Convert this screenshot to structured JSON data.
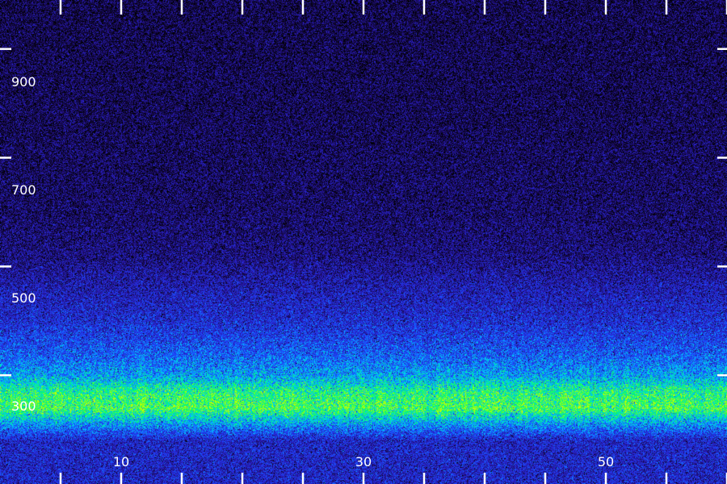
{
  "chart_data": {
    "type": "heatmap",
    "title": "",
    "xlabel": "",
    "ylabel": "",
    "x_range": [
      -5,
      55
    ],
    "y_range": [
      100,
      990
    ],
    "x_ticks": [
      {
        "value": 10,
        "label": "10"
      },
      {
        "value": 30,
        "label": "30"
      },
      {
        "value": 50,
        "label": "50"
      }
    ],
    "x_minor_ticks": [
      0,
      5,
      15,
      20,
      25,
      35,
      40,
      45,
      55
    ],
    "y_ticks": [
      {
        "value": 900,
        "label": "900"
      },
      {
        "value": 700,
        "label": "700"
      },
      {
        "value": 500,
        "label": "500"
      },
      {
        "value": 300,
        "label": "300"
      }
    ],
    "colormap": [
      "#000000",
      "#1a0a5a",
      "#2a20c8",
      "#1a4cff",
      "#00c8ff",
      "#00ff66",
      "#c8ff00"
    ],
    "intensity_profile": [
      {
        "y": 990,
        "level": 0.14
      },
      {
        "y": 800,
        "level": 0.15
      },
      {
        "y": 600,
        "level": 0.18
      },
      {
        "y": 520,
        "level": 0.22
      },
      {
        "y": 470,
        "level": 0.3
      },
      {
        "y": 400,
        "level": 0.38
      },
      {
        "y": 340,
        "level": 0.5
      },
      {
        "y": 300,
        "level": 0.62
      },
      {
        "y": 270,
        "level": 0.82
      },
      {
        "y": 240,
        "level": 0.88
      },
      {
        "y": 210,
        "level": 0.6
      },
      {
        "y": 180,
        "level": 0.35
      }
    ],
    "grid": false
  }
}
